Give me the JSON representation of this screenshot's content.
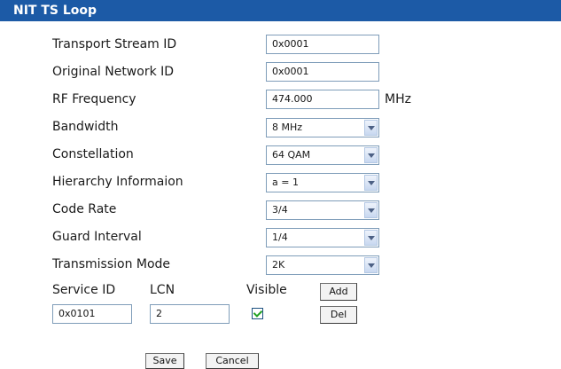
{
  "header": {
    "title": "NIT TS Loop"
  },
  "fields": {
    "transport_stream_id": {
      "label": "Transport Stream ID",
      "value": "0x0001"
    },
    "original_network_id": {
      "label": "Original Network ID",
      "value": "0x0001"
    },
    "rf_frequency": {
      "label": "RF Frequency",
      "value": "474.000",
      "unit": "MHz"
    },
    "bandwidth": {
      "label": "Bandwidth",
      "value": "8 MHz"
    },
    "constellation": {
      "label": "Constellation",
      "value": "64 QAM"
    },
    "hierarchy": {
      "label": "Hierarchy Informaion",
      "value": "a = 1"
    },
    "code_rate": {
      "label": "Code Rate",
      "value": "3/4"
    },
    "guard_interval": {
      "label": "Guard Interval",
      "value": "1/4"
    },
    "transmission_mode": {
      "label": "Transmission Mode",
      "value": "2K"
    }
  },
  "service": {
    "id_label": "Service ID",
    "lcn_label": "LCN",
    "visible_label": "Visible",
    "id_value": "0x0101",
    "lcn_value": "2",
    "visible_checked": true,
    "add_label": "Add",
    "del_label": "Del"
  },
  "footer": {
    "save_label": "Save",
    "cancel_label": "Cancel"
  },
  "colors": {
    "titlebar": "#1c5aa6",
    "checkmark": "#21a121"
  }
}
